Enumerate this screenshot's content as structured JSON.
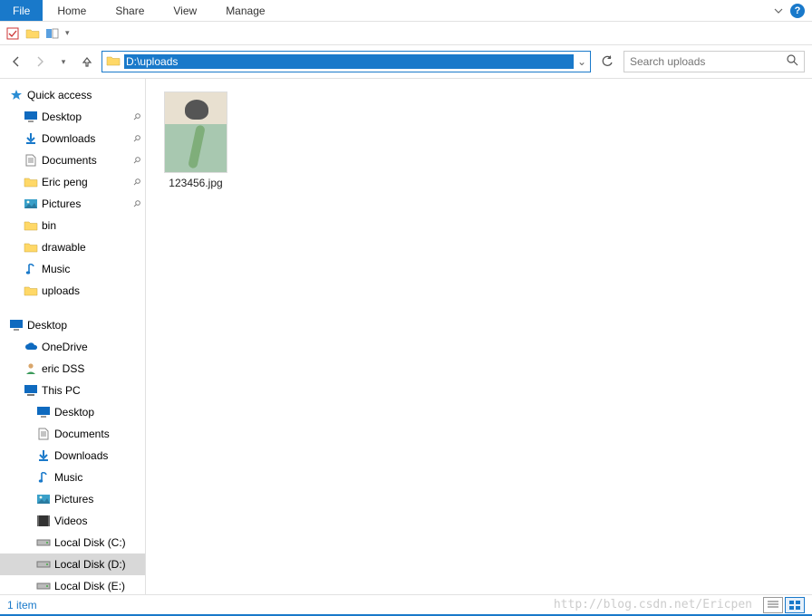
{
  "ribbon": {
    "file": "File",
    "home": "Home",
    "share": "Share",
    "view": "View",
    "manage": "Manage"
  },
  "address": {
    "path": "D:\\uploads"
  },
  "search": {
    "placeholder": "Search uploads"
  },
  "sidebar": {
    "quick_access": "Quick access",
    "qa_items": [
      {
        "label": "Desktop",
        "icon": "monitor",
        "pinned": true
      },
      {
        "label": "Downloads",
        "icon": "download",
        "pinned": true
      },
      {
        "label": "Documents",
        "icon": "document",
        "pinned": true
      },
      {
        "label": "Eric peng",
        "icon": "folder",
        "pinned": true
      },
      {
        "label": "Pictures",
        "icon": "pictures",
        "pinned": true
      },
      {
        "label": "bin",
        "icon": "folder",
        "pinned": false
      },
      {
        "label": "drawable",
        "icon": "folder",
        "pinned": false
      },
      {
        "label": "Music",
        "icon": "music",
        "pinned": false
      },
      {
        "label": "uploads",
        "icon": "folder",
        "pinned": false
      }
    ],
    "desktop": "Desktop",
    "desktop_items": [
      {
        "label": "OneDrive",
        "icon": "cloud"
      },
      {
        "label": "eric DSS",
        "icon": "user"
      },
      {
        "label": "This PC",
        "icon": "pc"
      }
    ],
    "thispc_items": [
      {
        "label": "Desktop",
        "icon": "monitor"
      },
      {
        "label": "Documents",
        "icon": "document"
      },
      {
        "label": "Downloads",
        "icon": "download"
      },
      {
        "label": "Music",
        "icon": "music"
      },
      {
        "label": "Pictures",
        "icon": "pictures"
      },
      {
        "label": "Videos",
        "icon": "video"
      },
      {
        "label": "Local Disk (C:)",
        "icon": "drive"
      },
      {
        "label": "Local Disk (D:)",
        "icon": "drive",
        "selected": true
      },
      {
        "label": "Local Disk (E:)",
        "icon": "drive"
      }
    ]
  },
  "files": [
    {
      "name": "123456.jpg"
    }
  ],
  "status": {
    "count": "1 item"
  },
  "watermark": "http://blog.csdn.net/Ericpen"
}
